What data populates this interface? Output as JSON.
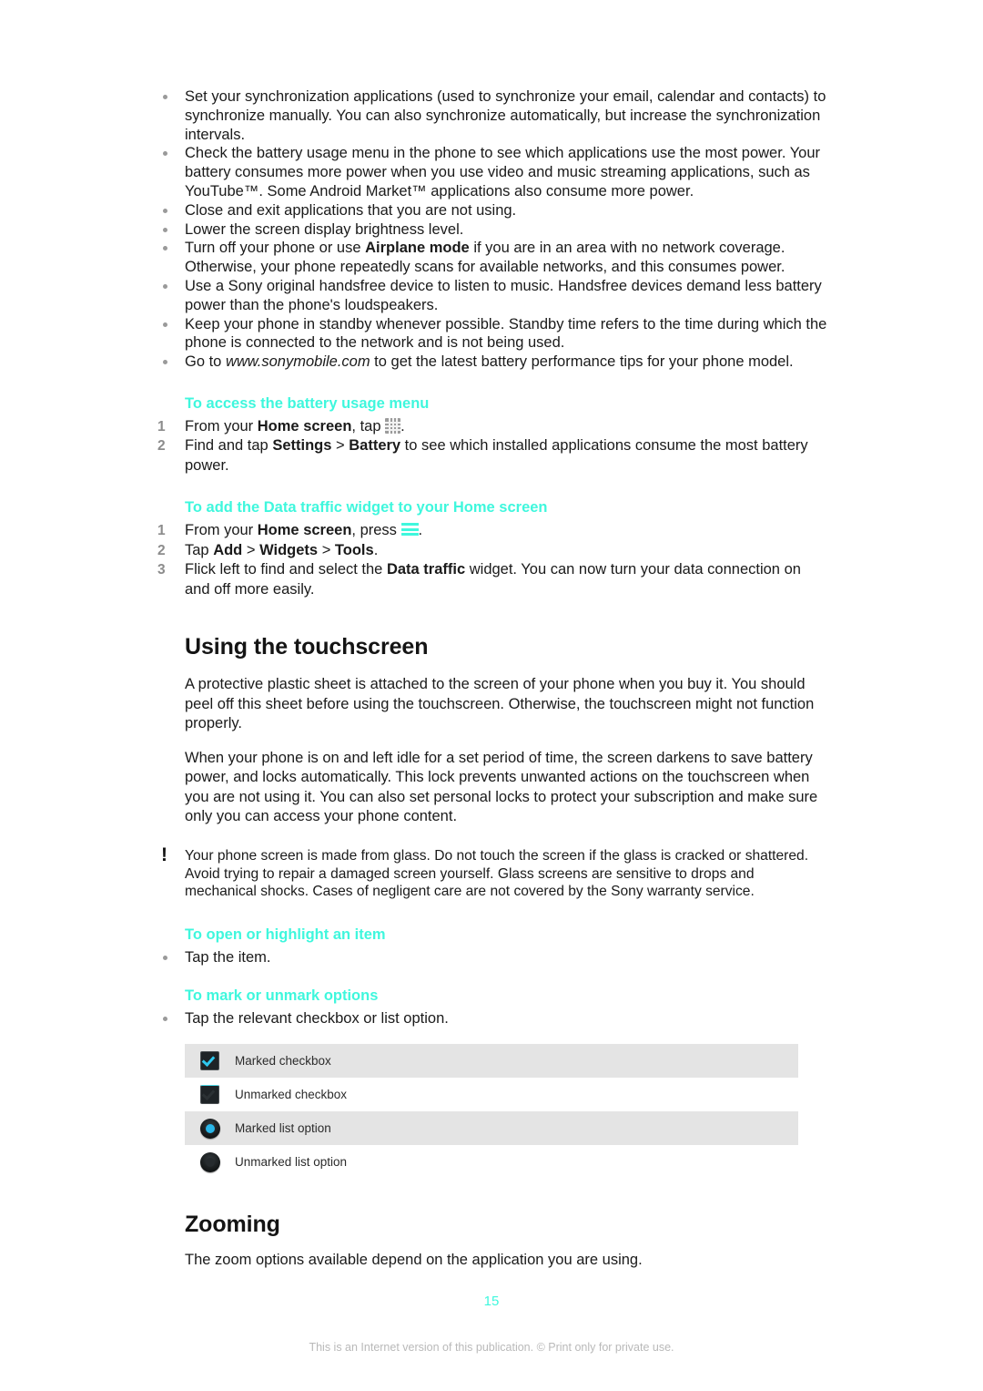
{
  "document": {
    "page_number": "15",
    "footer_note": "This is an Internet version of this publication. © Print only for private use.",
    "accent_color": "#3ff7dd",
    "bullet_color": "#9a9a9a",
    "row_shade_color": "#e4e4e4"
  },
  "battery_tips": {
    "items": [
      "Set your synchronization applications (used to synchronize your email, calendar and contacts) to synchronize manually. You can also synchronize automatically, but increase the synchronization intervals.",
      "Check the battery usage menu in the phone to see which applications use the most power. Your battery consumes more power when you use video and music streaming applications, such as YouTube™. Some Android Market™ applications also consume more power.",
      "Close and exit applications that you are not using.",
      "Lower the screen display brightness level.",
      "Use a Sony original handsfree device to listen to music. Handsfree devices demand less battery power than the phone's loudspeakers.",
      "Keep your phone in standby whenever possible. Standby time refers to the time during which the phone is connected to the network and is not being used."
    ],
    "airplane_item": {
      "pre": "Turn off your phone or use ",
      "bold": "Airplane mode",
      "post": " if you are in an area with no network coverage. Otherwise, your phone repeatedly scans for available networks, and this consumes power."
    },
    "url_item": {
      "pre": "Go to ",
      "url": "www.sonymobile.com",
      "post": " to get the latest battery performance tips for your phone model."
    }
  },
  "battery_usage_menu": {
    "heading": "To access the battery usage menu",
    "step1": {
      "pre": "From your ",
      "bold": "Home screen",
      "mid": ", tap ",
      "icon": "app-grid-icon",
      "post": "."
    },
    "step2": {
      "pre": "Find and tap ",
      "bold1": "Settings",
      "sep": " > ",
      "bold2": "Battery",
      "post": " to see which installed applications consume the most battery power."
    }
  },
  "data_traffic_widget": {
    "heading": "To add the Data traffic widget to your Home screen",
    "step1": {
      "pre": "From your ",
      "bold": "Home screen",
      "mid": ", press ",
      "icon": "menu-icon",
      "post": "."
    },
    "step2": {
      "pre": "Tap ",
      "bold1": "Add",
      "sep1": " > ",
      "bold2": "Widgets",
      "sep2": " > ",
      "bold3": "Tools",
      "post": "."
    },
    "step3": {
      "pre": "Flick left to find and select the ",
      "bold": "Data traffic",
      "post": " widget. You can now turn your data connection on and off more easily."
    }
  },
  "touchscreen": {
    "heading": "Using the touchscreen",
    "paragraph1": "A protective plastic sheet is attached to the screen of your phone when you buy it. You should peel off this sheet before using the touchscreen. Otherwise, the touchscreen might not function properly.",
    "paragraph2": "When your phone is on and left idle for a set period of time, the screen darkens to save battery power, and locks automatically. This lock prevents unwanted actions on the touchscreen when you are not using it. You can also set personal locks to protect your subscription and make sure only you can access your phone content.",
    "warning": "Your phone screen is made from glass. Do not touch the screen if the glass is cracked or shattered. Avoid trying to repair a damaged screen yourself. Glass screens are sensitive to drops and mechanical shocks. Cases of negligent care are not covered by the Sony warranty service.",
    "warning_icon": "exclamation-icon"
  },
  "open_highlight": {
    "heading": "To open or highlight an item",
    "item": "Tap the item."
  },
  "mark_unmark": {
    "heading": "To mark or unmark options",
    "item": "Tap the relevant checkbox or list option.",
    "rows": [
      {
        "icon": "marked-checkbox-icon",
        "label": "Marked checkbox",
        "shaded": true
      },
      {
        "icon": "unmarked-checkbox-icon",
        "label": "Unmarked checkbox",
        "shaded": false
      },
      {
        "icon": "marked-radio-icon",
        "label": "Marked list option",
        "shaded": true
      },
      {
        "icon": "unmarked-radio-icon",
        "label": "Unmarked list option",
        "shaded": false
      }
    ]
  },
  "zooming": {
    "heading": "Zooming",
    "paragraph": "The zoom options available depend on the application you are using."
  }
}
